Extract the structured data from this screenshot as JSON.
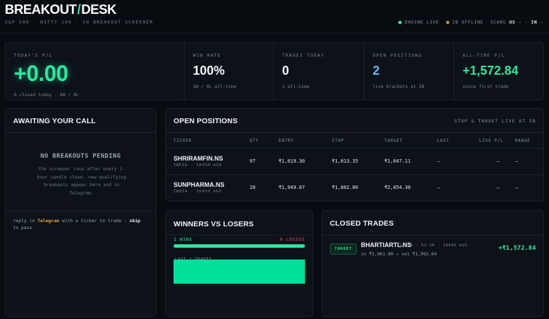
{
  "header": {
    "logo_left": "BREAKOUT",
    "logo_slash": "/",
    "logo_right": "DESK",
    "subtitle": "S&P 500 · NIFTY 100 · 1H BREAKOUT SCREENER",
    "engine_status": "ENGINE LIVE",
    "ib_status": "IB OFFLINE",
    "scans_label": "SCANS",
    "scans_us_label": "US",
    "scans_us_value": "—",
    "scans_sep": "·",
    "scans_in_label": "IN",
    "scans_in_value": "—",
    "colors": {
      "live": "#2ee59d",
      "offline": "#b8893a"
    }
  },
  "stats": {
    "pnl": {
      "label": "TODAY'S P/L",
      "value": "+0.00",
      "sub": "0 closed today · 0W / 0L"
    },
    "win_rate": {
      "label": "WIN RATE",
      "value": "100%",
      "sub": "1W / 0L all-time"
    },
    "trades_today": {
      "label": "TRADES TODAY",
      "value": "0",
      "sub": "1 all-time"
    },
    "open_positions": {
      "label": "OPEN POSITIONS",
      "value": "2",
      "sub": "live brackets at IB"
    },
    "all_time": {
      "label": "ALL-TIME P/L",
      "value": "+1,572.84",
      "sub": "since first trade"
    }
  },
  "awaiting": {
    "title": "AWAITING YOUR CALL",
    "empty_title": "NO BREAKOUTS PENDING",
    "empty_desc": "the screener runs after every 1-hour candle close. new qualifying breakouts appear here and in Telegram.",
    "footer_pre": "reply in ",
    "footer_telegram": "Telegram",
    "footer_mid": " with a ticker to trade · ",
    "footer_skip": "skip",
    "footer_post": " to pass"
  },
  "open_positions": {
    "title": "OPEN POSITIONS",
    "subtitle": "STOP & TARGET LIVE AT IB",
    "columns": [
      "TICKER",
      "QTY",
      "ENTRY",
      "STOP",
      "TARGET",
      "LAST",
      "LIVE P/L",
      "RANGE"
    ],
    "rows": [
      {
        "ticker": "SHRIRAMFIN.NS",
        "meta": "INDIA · 1045H AGO",
        "qty": "97",
        "entry": "₹1,019.30",
        "stop": "₹1,013.35",
        "target": "₹1,047.11",
        "last": "—",
        "live_pl": "—",
        "range": "—"
      },
      {
        "ticker": "SUNPHARMA.NS",
        "meta": "INDIA · 1045H AGO",
        "qty": "20",
        "entry": "₹1,949.07",
        "stop": "₹1,882.80",
        "target": "₹2,054.30",
        "last": "—",
        "live_pl": "—",
        "range": "—"
      }
    ]
  },
  "winners": {
    "title": "WINNERS VS LOSERS",
    "wins_label": "1 WINS",
    "losses_label": "0 LOSSES",
    "win_fraction": 1.0,
    "chart_label": "LAST 1 TRADES",
    "chart_values": [
      1572.84
    ]
  },
  "closed_trades": {
    "title": "CLOSED TRADES",
    "items": [
      {
        "badge": "TARGET",
        "ticker": "BHARTIARTL.NS",
        "meta": "INDIA · 51 SH · 1046H AGO",
        "detail": "in ₹1,961.80 → out ₹1,992.64",
        "pnl": "+₹1,572.84"
      }
    ]
  }
}
